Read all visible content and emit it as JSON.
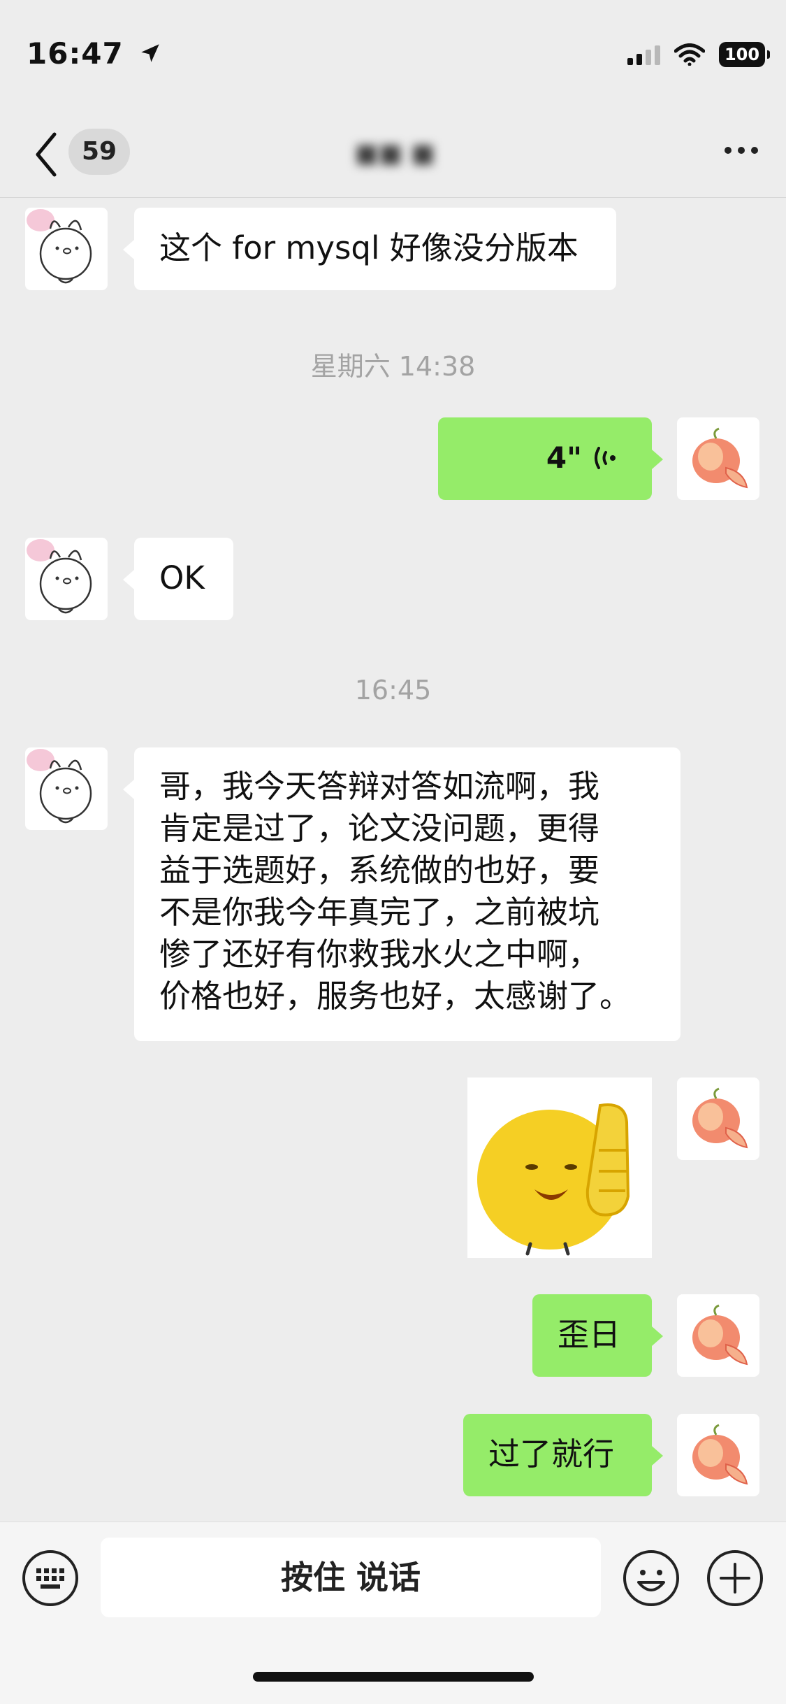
{
  "status_bar": {
    "time": "16:47",
    "battery": "100"
  },
  "nav": {
    "unread_count": "59",
    "title": "■■ ■"
  },
  "messages": {
    "m1": {
      "text": "这个 for mysql 好像没分版本"
    },
    "ts1": "星期六 14:38",
    "m2": {
      "duration": "4\""
    },
    "m3": {
      "text": "OK"
    },
    "ts2": "16:45",
    "m4": {
      "text": "哥，我今天答辩对答如流啊，我\n肯定是过了，论文没问题，更得\n益于选题好，系统做的也好，要\n不是你我今年真完了，之前被坑\n惨了还好有你救我水火之中啊，\n价格也好，服务也好，太感谢了。"
    },
    "m5": {
      "sticker": "thumbs-up-emoji-sticker"
    },
    "m6": {
      "text": "歪日"
    },
    "m7": {
      "text": "过了就行"
    }
  },
  "input": {
    "hold_to_talk": "按住 说话"
  },
  "colors": {
    "background": "#ededed",
    "sent_bubble": "#95ec69",
    "received_bubble": "#ffffff",
    "timestamp": "#a3a3a3"
  },
  "icons": [
    "location-arrow-icon",
    "signal-icon",
    "wifi-icon",
    "battery-icon",
    "back-chevron-icon",
    "more-icon",
    "voice-wave-icon",
    "keyboard-icon",
    "emoji-icon",
    "plus-icon"
  ]
}
